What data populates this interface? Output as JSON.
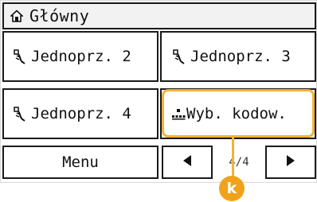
{
  "header": {
    "title": "Główny",
    "icon": "home-icon"
  },
  "buttons": [
    {
      "label": "Jednoprz. 2",
      "icon": "one-touch-key-icon"
    },
    {
      "label": "Jednoprz. 3",
      "icon": "one-touch-key-icon"
    },
    {
      "label": "Jednoprz. 4",
      "icon": "one-touch-key-icon"
    },
    {
      "label": "Wyb. kodow.",
      "icon": "coded-dial-icon"
    }
  ],
  "bottom": {
    "menu_label": "Menu",
    "page_indicator": "4/4",
    "prev_icon": "triangle-left-icon",
    "next_icon": "triangle-right-icon"
  },
  "callout": {
    "label": "k",
    "color": "#f0a31a"
  }
}
